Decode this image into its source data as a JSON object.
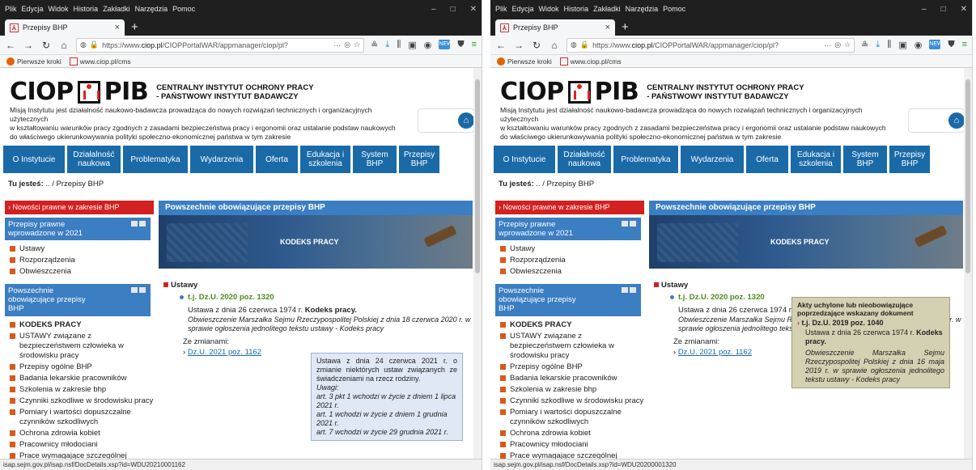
{
  "menu": [
    "Plik",
    "Edycja",
    "Widok",
    "Historia",
    "Zakładki",
    "Narzędzia",
    "Pomoc"
  ],
  "window_controls": [
    "–",
    "□",
    "✕"
  ],
  "tab": {
    "title": "Przepisy BHP",
    "close": "×",
    "new": "+"
  },
  "url": {
    "prefix": "https://www.",
    "domain": "ciop.pl",
    "path": "/CIOPPortalWAR/appmanager/ciop/pl?",
    "more": "···"
  },
  "bookmarks": [
    "Pierwsze kroki",
    "www.ciop.pl/cms"
  ],
  "site": {
    "logo_left": "CIOP",
    "logo_right": "PIB",
    "inst_line1": "CENTRALNY INSTYTUT OCHRONY PRACY",
    "inst_line2": "- PAŃSTWOWY INSTYTUT BADAWCZY",
    "mission_1": "Misją Instytutu jest działalność naukowo-badawcza prowadząca do nowych rozwiązań technicznych i organizacyjnych użytecznych",
    "mission_2": "w kształtowaniu warunków pracy zgodnych z zasadami bezpieczeństwa pracy i ergonomii oraz ustalanie podstaw naukowych",
    "mission_3": "do właściwego ukierunkowywania polityki społeczno-ekonomicznej państwa w tym zakresie"
  },
  "nav": [
    "O Instytucie",
    "Działalność naukowa",
    "Problematyka",
    "Wydarzenia",
    "Oferta",
    "Edukacja i szkolenia",
    "System BHP",
    "Przepisy BHP"
  ],
  "breadcrumb": {
    "label": "Tu jesteś:",
    "sep": "..",
    "slash": "/",
    "current": "Przepisy BHP"
  },
  "sidebar": {
    "news": "Nowości prawne w zakresie BHP",
    "head1": "Przepisy prawne wprowadzone w 2021",
    "list1": [
      "Ustawy",
      "Rozporządzenia",
      "Obwieszczenia"
    ],
    "head2": "Powszechnie obowiązujące przepisy BHP",
    "list2": [
      "KODEKS PRACY",
      "USTAWY związane z bezpieczeństwem człowieka w środowisku pracy",
      "Przepisy ogólne BHP",
      "Badania lekarskie pracowników",
      "Szkolenia w zakresie bhp",
      "Czynniki szkodliwe w środowisku pracy",
      "Pomiary i wartości dopuszczalne czynników szkodliwych",
      "Ochrona zdrowia kobiet",
      "Pracownicy młodociani",
      "Prace wymagające szczególnej sprawności psychofizycznej"
    ]
  },
  "content": {
    "header": "Powszechnie obowiązujące przepisy BHP",
    "banner": "KODEKS PRACY",
    "section": "Ustawy",
    "doc": "t.j. Dz.U. 2020 poz. 1320",
    "line_a": "Ustawa z dnia 26 czerwca 1974 r.",
    "line_a_bold": "Kodeks pracy.",
    "line_b": "Obwieszczenie Marszałka Sejmu Rzeczypospolitej Polskiej z dnia 18 czerwca 2020 r. w sprawie ogłoszenia jednolitego tekstu ustawy - Kodeks pracy",
    "changes": "Ze zmianami:",
    "change_link": "Dz.U. 2021 poz. 1162"
  },
  "tooltip_left": {
    "main": "Ustawa z dnia 24 czerwca 2021 r. o zmianie niektórych ustaw związanych ze świadczeniami na rzecz rodziny.",
    "uwagi": "Uwagi:",
    "n1": "art. 3 pkt 1 wchodzi w życie z dniem 1 lipca 2021 r.",
    "n2": "art. 1 wchodzi w życie z dniem 1 grudnia 2021 r.",
    "n3": "art. 7 wchodzi w życie 29 grudnia 2021 r."
  },
  "tooltip_right": {
    "title": "Akty uchylone lub nieobowiązujące poprzedzające wskazany dokument",
    "doc": "t.j. Dz.U. 2019 poz. 1040",
    "line": "Ustawa z dnia 26 czerwca 1974 r.",
    "line_bold": "Kodeks pracy.",
    "obw": "Obwieszczenie Marszałka Sejmu Rzeczypospolitej Polskiej z dnia 16 maja 2019 r. w sprawie ogłoszenia jednolitego tekstu ustawy - Kodeks pracy"
  },
  "status_left": "isap.sejm.gov.pl/isap.nsf/DocDetails.xsp?id=WDU20210001162",
  "status_right": "isap.sejm.gov.pl/isap.nsf/DocDetails.xsp?id=WDU20200001320",
  "colors": {
    "nav_blue": "#1a6aa8",
    "sidebar_blue": "#3b7ec2",
    "news_red": "#d32020",
    "doc_green": "#4a8a1a"
  }
}
